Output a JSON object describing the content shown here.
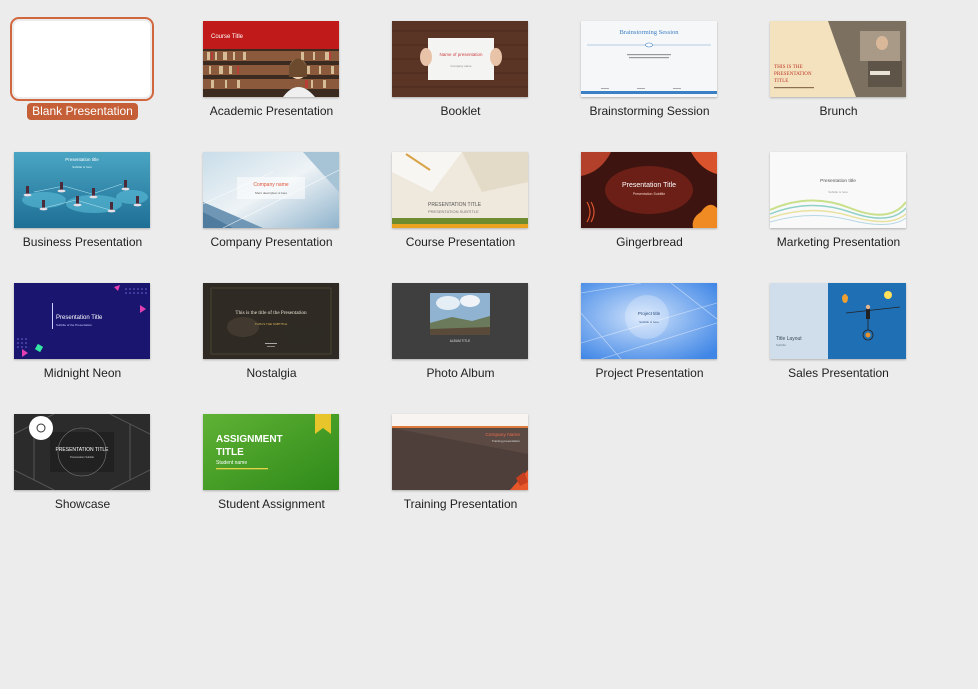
{
  "templates": [
    {
      "id": "blank",
      "label": "Blank Presentation",
      "selected": true,
      "thumb_text": []
    },
    {
      "id": "academic",
      "label": "Academic Presentation",
      "thumb_text": [
        "Course Title"
      ]
    },
    {
      "id": "booklet",
      "label": "Booklet",
      "thumb_text": [
        "Name of presentation",
        "Company name"
      ]
    },
    {
      "id": "brainstorming",
      "label": "Brainstorming Session",
      "thumb_text": [
        "Brainstorming Session"
      ]
    },
    {
      "id": "brunch",
      "label": "Brunch",
      "thumb_text": [
        "THIS IS THE",
        "PRESENTATION",
        "TITLE"
      ]
    },
    {
      "id": "business",
      "label": "Business Presentation",
      "thumb_text": [
        "Presentation title",
        "Subtitle is here"
      ]
    },
    {
      "id": "company",
      "label": "Company Presentation",
      "thumb_text": [
        "Company name",
        "Short description is here"
      ]
    },
    {
      "id": "course",
      "label": "Course Presentation",
      "thumb_text": [
        "PRESENTATION TITLE",
        "PRESENTATION SUBTITLE"
      ]
    },
    {
      "id": "gingerbread",
      "label": "Gingerbread",
      "thumb_text": [
        "Presentation Title",
        "Presentation Subtitle"
      ]
    },
    {
      "id": "marketing",
      "label": "Marketing Presentation",
      "thumb_text": [
        "Presentation title",
        "Subtitle is here"
      ]
    },
    {
      "id": "midnight",
      "label": "Midnight Neon",
      "thumb_text": [
        "Presentation Title",
        "Subtitle of the Presentation"
      ]
    },
    {
      "id": "nostalgia",
      "label": "Nostalgia",
      "thumb_text": [
        "This is the title of the Presentation",
        "THIS IS THE SUBTITLE"
      ]
    },
    {
      "id": "photo",
      "label": "Photo Album",
      "thumb_text": [
        "ALBUM TITLE"
      ]
    },
    {
      "id": "project",
      "label": "Project Presentation",
      "thumb_text": [
        "Project title",
        "Subtitle is here"
      ]
    },
    {
      "id": "sales",
      "label": "Sales Presentation",
      "thumb_text": [
        "Title Layout",
        "Subtitle"
      ]
    },
    {
      "id": "showcase",
      "label": "Showcase",
      "thumb_text": [
        "PRESENTATION TITLE",
        "Presentation Subtitle"
      ]
    },
    {
      "id": "student",
      "label": "Student Assignment",
      "thumb_text": [
        "ASSIGNMENT",
        "TITLE",
        "Student name"
      ]
    },
    {
      "id": "training",
      "label": "Training Presentation",
      "thumb_text": [
        "Company Name",
        "Training presentation"
      ]
    }
  ],
  "colors": {
    "background": "#ececec",
    "selection_accent": "#c55f37"
  }
}
